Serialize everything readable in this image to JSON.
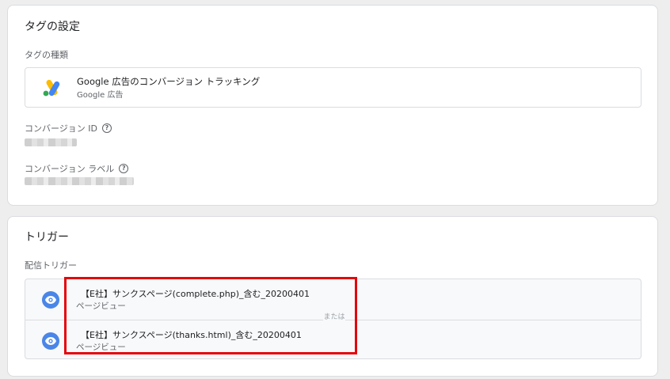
{
  "tag_config": {
    "title": "タグの設定",
    "tag_type_label": "タグの種類",
    "tag_type": {
      "name": "Google 広告のコンバージョン トラッキング",
      "provider": "Google 広告",
      "logo_icon": "google-ads-logo-icon"
    },
    "conversion_id_label": "コンバージョン ID",
    "conversion_label_label": "コンバージョン ラベル",
    "help_glyph": "?"
  },
  "triggering": {
    "title": "トリガー",
    "firing_label": "配信トリガー",
    "or_label": "または",
    "triggers": [
      {
        "name": "【E社】サンクスページ(complete.php)_含む_20200401",
        "type": "ページビュー",
        "icon": "eye-icon"
      },
      {
        "name": "【E社】サンクスページ(thanks.html)_含む_20200401",
        "type": "ページビュー",
        "icon": "eye-icon"
      }
    ]
  },
  "colors": {
    "accent_blue": "#4a86e8",
    "highlight_red": "#e3070d",
    "ads_yellow": "#fbbc04",
    "ads_blue": "#4285f4",
    "ads_green": "#34a853"
  }
}
